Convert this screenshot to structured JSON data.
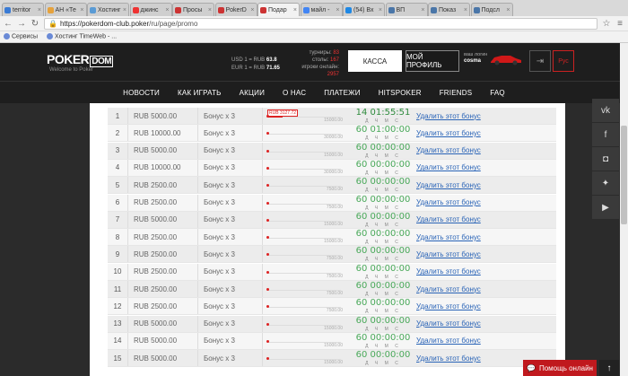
{
  "browser": {
    "tabs": [
      {
        "label": "territor",
        "color": "#3a7bd5"
      },
      {
        "label": "AH «Те",
        "color": "#e6a23c"
      },
      {
        "label": "Хостинг",
        "color": "#5a9bd5"
      },
      {
        "label": "джинс",
        "color": "#e33"
      },
      {
        "label": "Просы",
        "color": "#c33"
      },
      {
        "label": "PokerD",
        "color": "#c33"
      },
      {
        "label": "Подар",
        "color": "#c33"
      },
      {
        "label": "майл -",
        "color": "#4285f4"
      },
      {
        "label": "(54) Вх",
        "color": "#1e88e5"
      },
      {
        "label": "ВП",
        "color": "#4a76a8"
      },
      {
        "label": "Показ",
        "color": "#4a76a8"
      },
      {
        "label": "Подсл",
        "color": "#4a76a8"
      }
    ],
    "active_tab_index": 6,
    "url_host": "https://pokerdom-club.poker",
    "url_path": "/ru/page/promo",
    "bookmarks": [
      "Сервисы",
      "Хостинг TimeWeb - ..."
    ]
  },
  "header": {
    "logo": "POKER",
    "logo_dom": "DOM",
    "tagline": "Welcome to Poker",
    "rate_usd_label": "USD 1 = RUB",
    "rate_usd": "63.8",
    "rate_eur_label": "EUR 1 = RUB",
    "rate_eur": "71.65",
    "stat_tournaments_label": "турниры:",
    "stat_tournaments": "83",
    "stat_tables_label": "столы:",
    "stat_tables": "167",
    "stat_online_label": "игроки онлайн:",
    "stat_online": "2957",
    "cash_button": "КАССА",
    "profile_button": "МОЙ ПРОФИЛЬ",
    "user_label": "ваш логин",
    "username": "cosma",
    "lang": "Рус"
  },
  "nav": [
    "НОВОСТИ",
    "КАК ИГРАТЬ",
    "АКЦИИ",
    "О НАС",
    "ПЛАТЕЖИ",
    "HITSPOKER",
    "FRIENDS",
    "FAQ"
  ],
  "bonuses": {
    "bonus_label": "Бонус х 3",
    "delete_label": "Удалить этот бонус",
    "timer_units": "Д Ч М С",
    "rows": [
      {
        "num": "1",
        "amount": "RUB 5000.00",
        "max": "15000.00",
        "current": "RUB 3127.72",
        "progress": 0.2085,
        "timer": "14 01:55:51",
        "active": true
      },
      {
        "num": "2",
        "amount": "RUB 10000.00",
        "max": "30000.00",
        "current": "",
        "progress": 0,
        "timer": "60 01:00:00",
        "active": false
      },
      {
        "num": "3",
        "amount": "RUB 5000.00",
        "max": "15000.00",
        "current": "",
        "progress": 0,
        "timer": "60 00:00:00",
        "active": false
      },
      {
        "num": "4",
        "amount": "RUB 10000.00",
        "max": "30000.00",
        "current": "",
        "progress": 0,
        "timer": "60 00:00:00",
        "active": false
      },
      {
        "num": "5",
        "amount": "RUB 2500.00",
        "max": "7500.00",
        "current": "",
        "progress": 0,
        "timer": "60 00:00:00",
        "active": false
      },
      {
        "num": "6",
        "amount": "RUB 2500.00",
        "max": "7500.00",
        "current": "",
        "progress": 0,
        "timer": "60 00:00:00",
        "active": false
      },
      {
        "num": "7",
        "amount": "RUB 5000.00",
        "max": "15000.00",
        "current": "",
        "progress": 0,
        "timer": "60 00:00:00",
        "active": false
      },
      {
        "num": "8",
        "amount": "RUB 2500.00",
        "max": "15000.00",
        "current": "",
        "progress": 0,
        "timer": "60 00:00:00",
        "active": false
      },
      {
        "num": "9",
        "amount": "RUB 2500.00",
        "max": "7500.00",
        "current": "",
        "progress": 0,
        "timer": "60 00:00:00",
        "active": false
      },
      {
        "num": "10",
        "amount": "RUB 2500.00",
        "max": "7500.00",
        "current": "",
        "progress": 0,
        "timer": "60 00:00:00",
        "active": false
      },
      {
        "num": "11",
        "amount": "RUB 2500.00",
        "max": "7500.00",
        "current": "",
        "progress": 0,
        "timer": "60 00:00:00",
        "active": false
      },
      {
        "num": "12",
        "amount": "RUB 2500.00",
        "max": "7500.00",
        "current": "",
        "progress": 0,
        "timer": "60 00:00:00",
        "active": false
      },
      {
        "num": "13",
        "amount": "RUB 5000.00",
        "max": "15000.00",
        "current": "",
        "progress": 0,
        "timer": "60 00:00:00",
        "active": false
      },
      {
        "num": "14",
        "amount": "RUB 5000.00",
        "max": "15000.00",
        "current": "",
        "progress": 0,
        "timer": "60 00:00:00",
        "active": false
      },
      {
        "num": "15",
        "amount": "RUB 5000.00",
        "max": "15000.00",
        "current": "",
        "progress": 0,
        "timer": "60 00:00:00",
        "active": false
      }
    ]
  },
  "social": [
    "vk-icon",
    "facebook-icon",
    "instagram-icon",
    "twitter-icon",
    "youtube-icon"
  ],
  "help_button": "Помощь онлайн"
}
